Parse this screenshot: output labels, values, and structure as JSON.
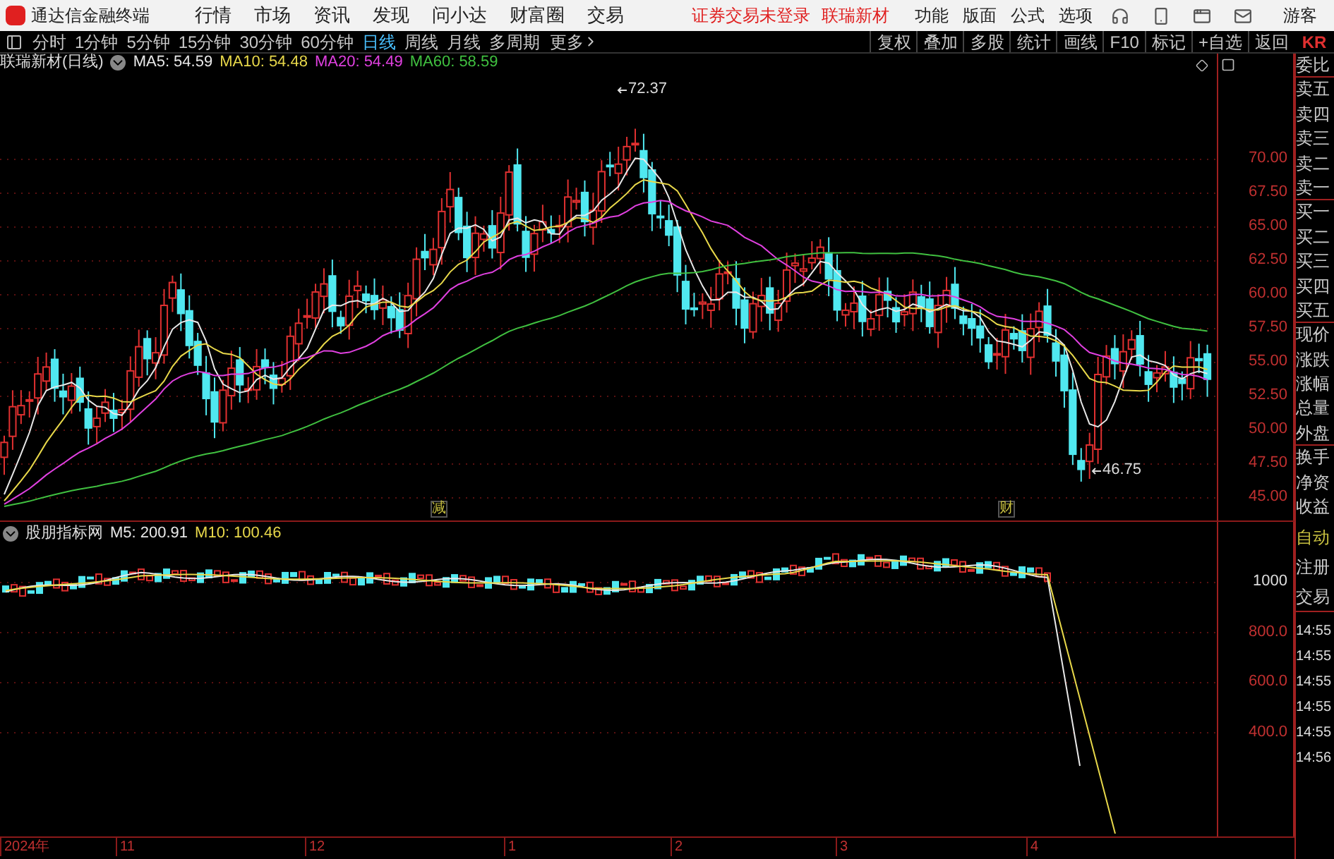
{
  "top_bar": {
    "app_name": "通达信金融终端",
    "menu": [
      {
        "label": "行情"
      },
      {
        "label": "市场"
      },
      {
        "label": "资讯"
      },
      {
        "label": "发现"
      },
      {
        "label": "问小达"
      },
      {
        "label": "财富圈"
      },
      {
        "label": "交易"
      }
    ],
    "notice": "证券交易未登录",
    "stock_link": "联瑞新材",
    "right_menu": [
      "功能",
      "版面",
      "公式",
      "选项"
    ],
    "user": "游客"
  },
  "period_bar": {
    "periods": [
      {
        "label": "分时",
        "selected": false
      },
      {
        "label": "1分钟",
        "selected": false
      },
      {
        "label": "5分钟",
        "selected": false
      },
      {
        "label": "15分钟",
        "selected": false
      },
      {
        "label": "30分钟",
        "selected": false
      },
      {
        "label": "60分钟",
        "selected": false
      },
      {
        "label": "日线",
        "selected": true
      },
      {
        "label": "周线",
        "selected": false
      },
      {
        "label": "月线",
        "selected": false
      },
      {
        "label": "多周期",
        "selected": false
      }
    ],
    "more": "更多",
    "tools": [
      "复权",
      "叠加",
      "多股",
      "统计",
      "画线",
      "F10",
      "标记",
      "+自选",
      "返回"
    ]
  },
  "price_chart": {
    "title": "联瑞新材(日线)",
    "ma": [
      {
        "label": "MA5: 54.59",
        "color": "#e8e8e8"
      },
      {
        "label": "MA10: 54.48",
        "color": "#e8d84a"
      },
      {
        "label": "MA20: 54.49",
        "color": "#e040e0"
      },
      {
        "label": "MA60: 58.59",
        "color": "#40c040"
      }
    ],
    "yticks": [
      "70.00",
      "67.50",
      "65.00",
      "62.50",
      "60.00",
      "57.50",
      "55.00",
      "52.50",
      "50.00",
      "47.50",
      "45.00"
    ],
    "high_label": "72.37",
    "low_label": "46.75",
    "event_marks": [
      "减",
      "财"
    ]
  },
  "indicator": {
    "title": "股朋指标网",
    "ma": [
      {
        "label": "M5: 200.91",
        "color": "#e8e8e8"
      },
      {
        "label": "M10: 100.46",
        "color": "#e8d84a"
      }
    ],
    "yticks": [
      "1000",
      "800.0",
      "600.0",
      "400.0"
    ]
  },
  "date_axis": [
    "2024年",
    "11",
    "12",
    "1",
    "2",
    "3",
    "4"
  ],
  "right_panel": {
    "code": "KR",
    "quote_labels": [
      "委比",
      "卖五",
      "卖四",
      "卖三",
      "卖二",
      "卖一",
      "买一",
      "买二",
      "买三",
      "买四",
      "买五",
      "现价",
      "涨跌",
      "涨幅",
      "总量",
      "外盘",
      "换手",
      "净资",
      "收益"
    ],
    "trade_buttons": [
      {
        "label": "自动",
        "kind": "highlight"
      },
      {
        "label": "注册",
        "kind": "plain"
      },
      {
        "label": "交易",
        "kind": "plain"
      }
    ],
    "ticks": [
      "14:55",
      "14:55",
      "14:55",
      "14:55",
      "14:55",
      "14:56"
    ]
  }
}
